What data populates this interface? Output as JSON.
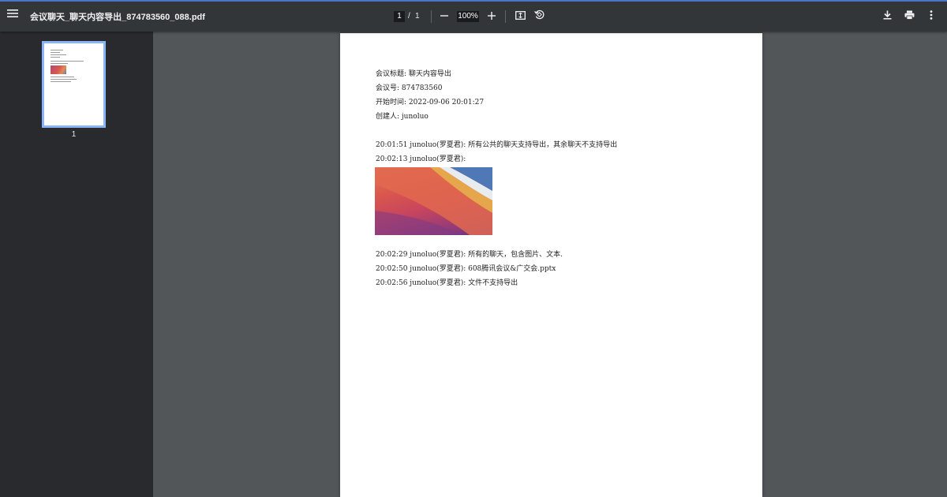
{
  "toolbar": {
    "title": "会议聊天_聊天内容导出_874783560_088.pdf",
    "current_page": "1",
    "page_separator": "/",
    "total_pages": "1",
    "zoom": "100%"
  },
  "icons": [
    "menu-icon",
    "zoom-out-icon",
    "zoom-in-icon",
    "fit-page-icon",
    "rotate-icon",
    "download-icon",
    "print-icon",
    "more-vert-icon"
  ],
  "sidebar": {
    "thumbnail_label": "1"
  },
  "document": {
    "meta": [
      "会议标题: 聊天内容导出",
      "会议号: 874783560",
      "开始时间: 2022-09-06 20:01:27",
      "创建人: junoluo"
    ],
    "messages_before_image": [
      "20:01:51 junoluo(罗夏君): 所有公共的聊天支持导出，其余聊天不支持导出",
      "20:02:13 junoluo(罗夏君):"
    ],
    "messages_after_image": [
      "20:02:29 junoluo(罗夏君): 所有的聊天，包含图片、文本.",
      "20:02:50 junoluo(罗夏君): 608腾讯会议&广交会.pptx",
      "20:02:56 junoluo(罗夏君): 文件不支持导出"
    ]
  },
  "colors": {
    "toolbar_bg": "#323639",
    "sidebar_bg": "#292a2d",
    "viewer_bg": "#525659",
    "thumbnail_border": "#8ab4f8",
    "accent_line": "#4a7bd0"
  }
}
